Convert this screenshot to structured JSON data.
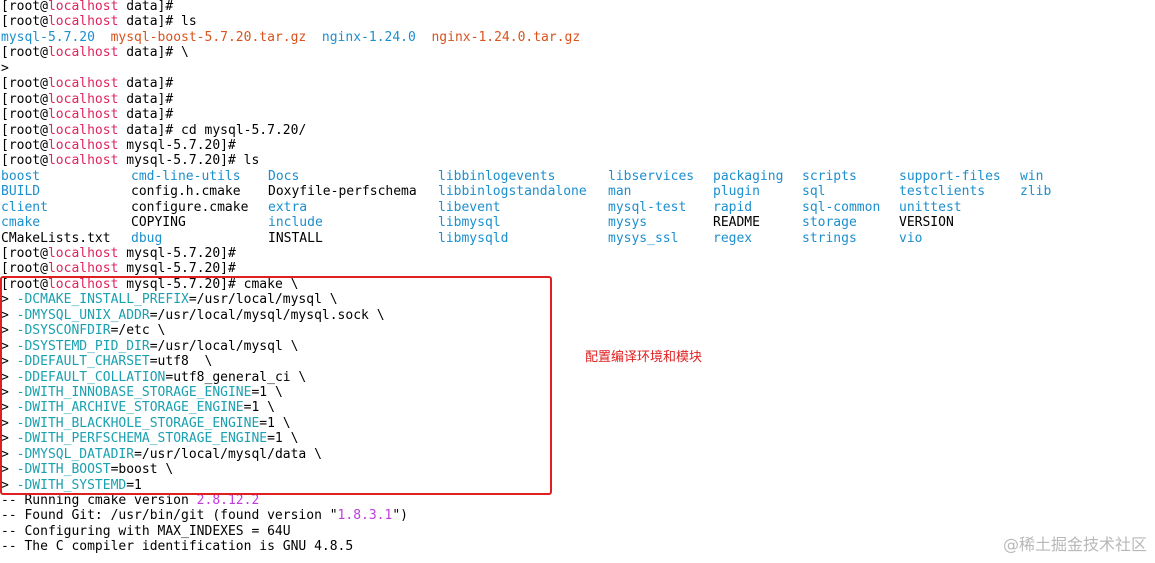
{
  "prompt": {
    "open": "[",
    "user": "root",
    "at": "@",
    "host": "localhost",
    "dir_data": "data",
    "dir_mysql": "mysql-5.7.20",
    "close": "]#"
  },
  "commands": {
    "ls": "ls",
    "backslash": "\\",
    "continuation": ">",
    "cd": "cd mysql-5.7.20/",
    "cmake": "cmake \\"
  },
  "ls_data": [
    {
      "text": "mysql-5.7.20",
      "color": "blue"
    },
    {
      "text": "mysql-boost-5.7.20.tar.gz",
      "color": "orange"
    },
    {
      "text": "nginx-1.24.0",
      "color": "blue"
    },
    {
      "text": "nginx-1.24.0.tar.gz",
      "color": "orange"
    }
  ],
  "ls_mysql": {
    "rows": [
      [
        "boost",
        "cmd-line-utils",
        "Docs",
        "libbinlogevents",
        "libservices",
        "packaging",
        "scripts",
        "support-files",
        "win"
      ],
      [
        "BUILD",
        "config.h.cmake",
        "Doxyfile-perfschema",
        "libbinlogstandalone",
        "man",
        "plugin",
        "sql",
        "testclients",
        "zlib"
      ],
      [
        "client",
        "configure.cmake",
        "extra",
        "libevent",
        "mysql-test",
        "rapid",
        "sql-common",
        "unittest",
        ""
      ],
      [
        "cmake",
        "COPYING",
        "include",
        "libmysql",
        "mysys",
        "README",
        "storage",
        "VERSION",
        ""
      ],
      [
        "CMakeLists.txt",
        "dbug",
        "INSTALL",
        "libmysqld",
        "mysys_ssl",
        "regex",
        "strings",
        "vio",
        ""
      ]
    ],
    "colors": [
      [
        "blue",
        "blue",
        "blue",
        "blue",
        "blue",
        "blue",
        "blue",
        "blue",
        "blue"
      ],
      [
        "blue",
        "black",
        "black",
        "blue",
        "blue",
        "blue",
        "blue",
        "blue",
        "blue"
      ],
      [
        "blue",
        "black",
        "blue",
        "blue",
        "blue",
        "blue",
        "blue",
        "blue",
        ""
      ],
      [
        "blue",
        "black",
        "blue",
        "blue",
        "blue",
        "black",
        "blue",
        "black",
        ""
      ],
      [
        "black",
        "blue",
        "black",
        "blue",
        "blue",
        "blue",
        "blue",
        "blue",
        ""
      ]
    ]
  },
  "cmake_opts": [
    {
      "key": "-DCMAKE_INSTALL_PREFIX",
      "val": "=/usr/local/mysql \\"
    },
    {
      "key": "-DMYSQL_UNIX_ADDR",
      "val": "=/usr/local/mysql/mysql.sock \\"
    },
    {
      "key": "-DSYSCONFDIR",
      "val": "=/etc \\"
    },
    {
      "key": "-DSYSTEMD_PID_DIR",
      "val": "=/usr/local/mysql \\"
    },
    {
      "key": "-DDEFAULT_CHARSET",
      "val": "=utf8  \\"
    },
    {
      "key": "-DDEFAULT_COLLATION",
      "val": "=utf8_general_ci \\"
    },
    {
      "key": "-DWITH_INNOBASE_STORAGE_ENGINE",
      "val": "=1 \\"
    },
    {
      "key": "-DWITH_ARCHIVE_STORAGE_ENGINE",
      "val": "=1 \\"
    },
    {
      "key": "-DWITH_BLACKHOLE_STORAGE_ENGINE",
      "val": "=1 \\"
    },
    {
      "key": "-DWITH_PERFSCHEMA_STORAGE_ENGINE",
      "val": "=1 \\"
    },
    {
      "key": "-DMYSQL_DATADIR",
      "val": "=/usr/local/mysql/data \\"
    },
    {
      "key": "-DWITH_BOOST",
      "val": "=boost \\"
    },
    {
      "key": "-DWITH_SYSTEMD",
      "val": "=1"
    }
  ],
  "output": {
    "l1_prefix": "-- Running cmake version ",
    "l1_version": "2.8.12.2",
    "l2_prefix": "-- Found Git: /usr/bin/git (found version \"",
    "l2_version": "1.8.3.1",
    "l2_suffix": "\")",
    "l3": "-- Configuring with MAX_INDEXES = 64U",
    "l4": "-- The C compiler identification is GNU 4.8.5"
  },
  "annotation": "配置编译环境和模块",
  "watermark": "@稀土掘金技术社区",
  "colors": {
    "prompt_host": "#e0245e",
    "dir": "#1c8fce",
    "archive": "#d9531e",
    "option": "#1aa0b0",
    "version": "#c23be0",
    "box": "#e02020"
  }
}
